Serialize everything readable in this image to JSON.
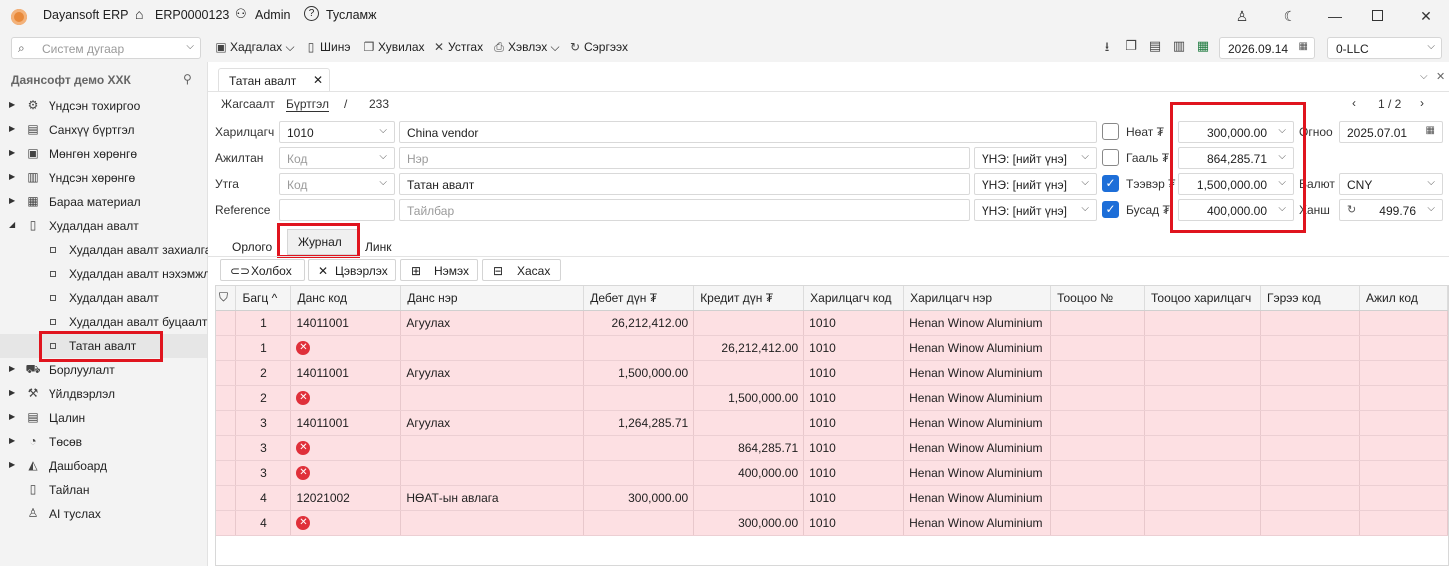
{
  "titlebar": {
    "app_name": "Dayansoft ERP",
    "erp_code": "ERP0000123",
    "user": "Admin",
    "help": "Тусламж"
  },
  "toolbar": {
    "search_placeholder": "Систем дугаар",
    "save": "Хадгалах",
    "new": "Шинэ",
    "copy": "Хувилах",
    "delete": "Устгах",
    "print": "Хэвлэх",
    "refresh": "Сэргээх",
    "date": "2026.09.14",
    "company": "0-LLC"
  },
  "sidebar": {
    "org_name": "Даянсофт демо ХХК",
    "items": [
      {
        "label": "Үндсэн тохиргоо",
        "icon": "gear-icon"
      },
      {
        "label": "Санхүү бүртгэл",
        "icon": "ledger-icon"
      },
      {
        "label": "Мөнгөн хөрөнгө",
        "icon": "cash-icon"
      },
      {
        "label": "Үндсэн хөрөнгө",
        "icon": "building-icon"
      },
      {
        "label": "Бараа материал",
        "icon": "box-icon"
      },
      {
        "label": "Худалдан авалт",
        "icon": "purchase-icon"
      },
      {
        "label": "Борлуулалт",
        "icon": "cart-icon"
      },
      {
        "label": "Үйлдвэрлэл",
        "icon": "factory-icon"
      },
      {
        "label": "Цалин",
        "icon": "salary-icon"
      },
      {
        "label": "Төсөв",
        "icon": "pie-icon"
      },
      {
        "label": "Дашбоард",
        "icon": "dashboard-icon"
      },
      {
        "label": "Тайлан",
        "icon": "report-icon"
      },
      {
        "label": "AI туслах",
        "icon": "ai-icon"
      }
    ],
    "sub_items": [
      {
        "label": "Худалдан авалт захиалга"
      },
      {
        "label": "Худалдан авалт нэхэмжлэл"
      },
      {
        "label": "Худалдан авалт"
      },
      {
        "label": "Худалдан авалт буцаалт"
      },
      {
        "label": "Татан авалт"
      }
    ]
  },
  "document": {
    "tab_title": "Татан авалт",
    "breadcrumb": {
      "list": "Жагсаалт",
      "register": "Бүртгэл",
      "sep": "/",
      "number": "233"
    },
    "pager": "1 / 2",
    "labels": {
      "partner": "Харилцагч",
      "employee": "Ажилтан",
      "description": "Утга",
      "reference": "Reference",
      "vat": "Нөат ₮",
      "customs": "Гааль ₮",
      "transport": "Тээвэр ₮",
      "other": "Бусад ₮",
      "date": "Огноо",
      "currency": "Валют",
      "rate": "Ханш"
    },
    "partner_code": "1010",
    "partner_name": "China vendor",
    "employee_code_placeholder": "Код",
    "employee_name_placeholder": "Нэр",
    "desc_code_placeholder": "Код",
    "desc_text": "Татан авалт",
    "reference_value": "",
    "note_placeholder": "Тайлбар",
    "price_type": "ҮНЭ: [нийт үнэ]",
    "vat_amount": "300,000.00",
    "customs_amount": "864,285.71",
    "transport_amount": "1,500,000.00",
    "other_amount": "400,000.00",
    "vat_checked": false,
    "customs_checked": false,
    "transport_checked": true,
    "other_checked": true,
    "date_value": "2025.07.01",
    "currency_value": "CNY",
    "rate_value": "499.76",
    "subtabs": [
      "Орлого",
      "Журнал",
      "Линк"
    ],
    "grid_buttons": {
      "link": "Холбох",
      "clear": "Цэвэрлэх",
      "add": "Нэмэх",
      "remove": "Хасах"
    }
  },
  "journal": {
    "columns": [
      "Багц",
      "Данс код",
      "Данс нэр",
      "Дебет дүн ₮",
      "Кредит дүн ₮",
      "Харилцагч код",
      "Харилцагч нэр",
      "Тооцоо №",
      "Тооцоо харилцагч",
      "Гэрээ код",
      "Ажил код"
    ],
    "rows": [
      {
        "batch": "1",
        "account": "14011001",
        "account_name": "Агуулах",
        "debit": "26,212,412.00",
        "credit": "",
        "partner_code": "1010",
        "partner_name": "Henan Winow Aluminium",
        "error": false
      },
      {
        "batch": "1",
        "account": "",
        "account_name": "",
        "debit": "",
        "credit": "26,212,412.00",
        "partner_code": "1010",
        "partner_name": "Henan Winow Aluminium",
        "error": true
      },
      {
        "batch": "2",
        "account": "14011001",
        "account_name": "Агуулах",
        "debit": "1,500,000.00",
        "credit": "",
        "partner_code": "1010",
        "partner_name": "Henan Winow Aluminium",
        "error": false
      },
      {
        "batch": "2",
        "account": "",
        "account_name": "",
        "debit": "",
        "credit": "1,500,000.00",
        "partner_code": "1010",
        "partner_name": "Henan Winow Aluminium",
        "error": true
      },
      {
        "batch": "3",
        "account": "14011001",
        "account_name": "Агуулах",
        "debit": "1,264,285.71",
        "credit": "",
        "partner_code": "1010",
        "partner_name": "Henan Winow Aluminium",
        "error": false
      },
      {
        "batch": "3",
        "account": "",
        "account_name": "",
        "debit": "",
        "credit": "864,285.71",
        "partner_code": "1010",
        "partner_name": "Henan Winow Aluminium",
        "error": true
      },
      {
        "batch": "3",
        "account": "",
        "account_name": "",
        "debit": "",
        "credit": "400,000.00",
        "partner_code": "1010",
        "partner_name": "Henan Winow Aluminium",
        "error": true
      },
      {
        "batch": "4",
        "account": "12021002",
        "account_name": "НӨАТ-ын авлага",
        "debit": "300,000.00",
        "credit": "",
        "partner_code": "1010",
        "partner_name": "Henan Winow Aluminium",
        "error": false
      },
      {
        "batch": "4",
        "account": "",
        "account_name": "",
        "debit": "",
        "credit": "300,000.00",
        "partner_code": "1010",
        "partner_name": "Henan Winow Aluminium",
        "error": true
      }
    ]
  }
}
